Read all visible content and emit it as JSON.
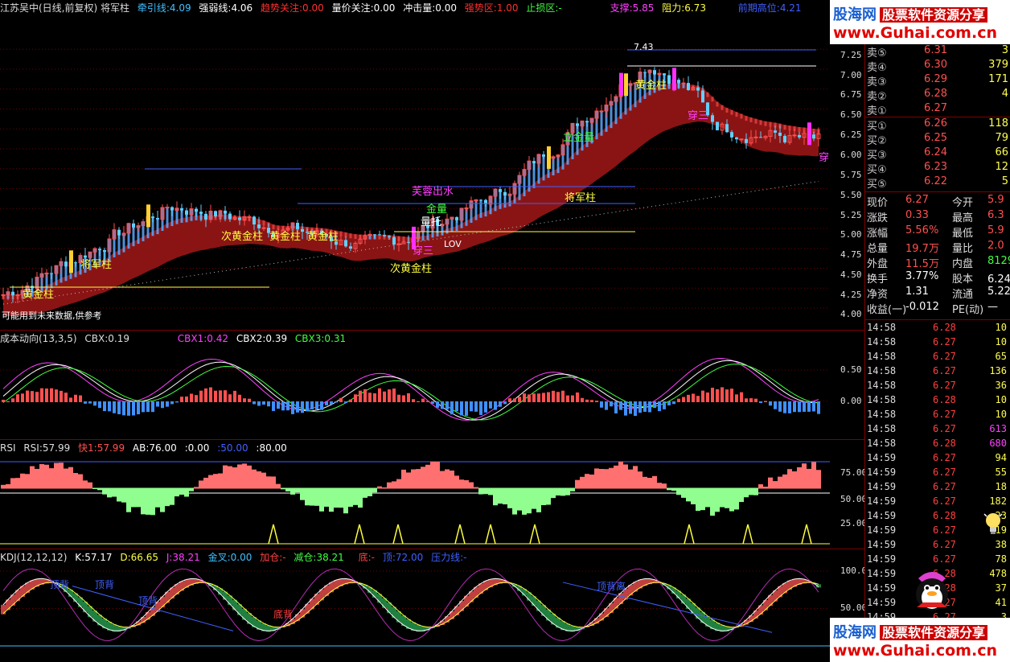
{
  "main_header": {
    "title": "江苏吴中(日线,前复权) 将军柱",
    "qianyin": "牵引线:4.09",
    "qiangruo": "强弱线:4.06",
    "qushi": "趋势关注:0.00",
    "liangjia": "量价关注:0.00",
    "chongji": "冲击量:0.00",
    "qiangshi": "强势区:1.00",
    "zhisun": "止损区:-",
    "zhicheng": "支撑:5.85",
    "zuli": "阻力:6.73",
    "qianqi": "前期高位:4.21"
  },
  "main_labels": {
    "huangjin1": "黄金柱",
    "jiangjun1": "将军柱",
    "cihuang1": "次黄金柱",
    "huangjin_mid1": "黄金柱",
    "huangjin_mid2": "黄金柱",
    "cihuang2": "次黄金柱",
    "chuan1": "穿三",
    "lov": "LOV",
    "lianglu": "量托",
    "jiangjun2": "将军柱",
    "lijinliang": "立金量",
    "huangjin_top": "黄金柱",
    "chuan2": "穿三",
    "peak": "7.43",
    "chuan_right": "穿",
    "note": "可能用到未来数据,供参考",
    "furong": "芙蓉出水",
    "jinliang2": "金量"
  },
  "main_axis": [
    "7.25",
    "7.00",
    "6.75",
    "6.50",
    "6.25",
    "6.00",
    "5.75",
    "5.50",
    "5.25",
    "5.00",
    "4.75",
    "4.50",
    "4.25",
    "4.00"
  ],
  "cbx_header": {
    "name": "成本动向(13,3,5)",
    "cbx": "CBX:0.19",
    "cbx1": "CBX1:0.42",
    "cbx2": "CBX2:0.39",
    "cbx3": "CBX3:0.31"
  },
  "cbx_axis": [
    "0.50",
    "0.00"
  ],
  "rsi_header": {
    "name": "RSI",
    "rsi": "RSI:57.99",
    "fast": "快1:57.99",
    "ab": "AB:76.00",
    "v1": ":0.00",
    "v2": ":50.00",
    "v3": ":80.00"
  },
  "rsi_axis": [
    "75.00",
    "50.00",
    "25.00"
  ],
  "kdj_header": {
    "name": "KDJ(12,12,12)",
    "k": "K:57.17",
    "d": "D:66.65",
    "j": "J:38.21",
    "jincha": "金叉:0.00",
    "jiacang": "加仓:-",
    "jiancang": "减仓:38.21",
    "di": "底:-",
    "ding": "顶:72.00",
    "yali": "压力线:-"
  },
  "kdj_labels": {
    "dingbei1": "顶背",
    "dingbei2": "顶背",
    "dingbei3": "顶背",
    "dibei": "底背",
    "dingbeili": "顶背离"
  },
  "kdj_axis": [
    "100.0",
    "50.00"
  ],
  "logo": {
    "brand": "股海网",
    "slogan": "股票软件资源分享",
    "url": "www.Guhai.com.cn"
  },
  "quotes": {
    "sell": [
      {
        "label": "卖⑤",
        "price": "6.31",
        "vol": "3"
      },
      {
        "label": "卖④",
        "price": "6.30",
        "vol": "379"
      },
      {
        "label": "卖③",
        "price": "6.29",
        "vol": "171"
      },
      {
        "label": "卖②",
        "price": "6.28",
        "vol": "4"
      },
      {
        "label": "卖①",
        "price": "6.27",
        "vol": ""
      }
    ],
    "buy": [
      {
        "label": "买①",
        "price": "6.26",
        "vol": "118"
      },
      {
        "label": "买②",
        "price": "6.25",
        "vol": "79"
      },
      {
        "label": "买③",
        "price": "6.24",
        "vol": "66"
      },
      {
        "label": "买④",
        "price": "6.23",
        "vol": "12"
      },
      {
        "label": "买⑤",
        "price": "6.22",
        "vol": "5"
      }
    ]
  },
  "stats": [
    {
      "l1": "现价",
      "v1": "6.27",
      "l2": "今开",
      "v2": "5.9"
    },
    {
      "l1": "涨跌",
      "v1": "0.33",
      "l2": "最高",
      "v2": "6.3"
    },
    {
      "l1": "涨幅",
      "v1": "5.56%",
      "l2": "最低",
      "v2": "5.9"
    },
    {
      "l1": "总量",
      "v1": "19.7万",
      "l2": "量比",
      "v2": "2.0"
    },
    {
      "l1": "外盘",
      "v1": "11.5万",
      "l2": "内盘",
      "v2": "8129"
    },
    {
      "l1": "换手",
      "v1": "3.77%",
      "l2": "股本",
      "v2": "6.24亿"
    },
    {
      "l1": "净资",
      "v1": "1.31",
      "l2": "流通",
      "v2": "5.22"
    },
    {
      "l1": "收益(一)",
      "v1": "-0.012",
      "l2": "PE(动)",
      "v2": "—"
    }
  ],
  "trades": [
    {
      "t": "14:58",
      "p": "6.28",
      "v": "10"
    },
    {
      "t": "14:58",
      "p": "6.27",
      "v": "10"
    },
    {
      "t": "14:58",
      "p": "6.27",
      "v": "65"
    },
    {
      "t": "14:58",
      "p": "6.27",
      "v": "136"
    },
    {
      "t": "14:58",
      "p": "6.27",
      "v": "36"
    },
    {
      "t": "14:58",
      "p": "6.28",
      "v": "10"
    },
    {
      "t": "14:58",
      "p": "6.27",
      "v": "10"
    },
    {
      "t": "14:58",
      "p": "6.27",
      "v": "613"
    },
    {
      "t": "14:58",
      "p": "6.28",
      "v": "680"
    },
    {
      "t": "14:59",
      "p": "6.27",
      "v": "94"
    },
    {
      "t": "14:59",
      "p": "6.27",
      "v": "55"
    },
    {
      "t": "14:59",
      "p": "6.27",
      "v": "18"
    },
    {
      "t": "14:59",
      "p": "6.27",
      "v": "182"
    },
    {
      "t": "14:59",
      "p": "6.28",
      "v": "23"
    },
    {
      "t": "14:59",
      "p": "6.27",
      "v": "19"
    },
    {
      "t": "14:59",
      "p": "6.27",
      "v": "38"
    },
    {
      "t": "14:59",
      "p": "6.27",
      "v": "78"
    },
    {
      "t": "14:59",
      "p": "6.28",
      "v": "478"
    },
    {
      "t": "14:59",
      "p": "6.28",
      "v": "37"
    },
    {
      "t": "14:59",
      "p": "6.27",
      "v": "41"
    },
    {
      "t": "14:59",
      "p": "6.27",
      "v": "3"
    },
    {
      "t": "14:59",
      "p": "6.27",
      "v": "13"
    },
    {
      "t": "15:00",
      "p": "6.27",
      "v": "30"
    }
  ],
  "colors": {
    "bg": "#000000",
    "grid": "#800000",
    "up": "#ff5050",
    "down": "#50a0ff",
    "band": "#a01818",
    "text_yellow": "#ffff50"
  }
}
